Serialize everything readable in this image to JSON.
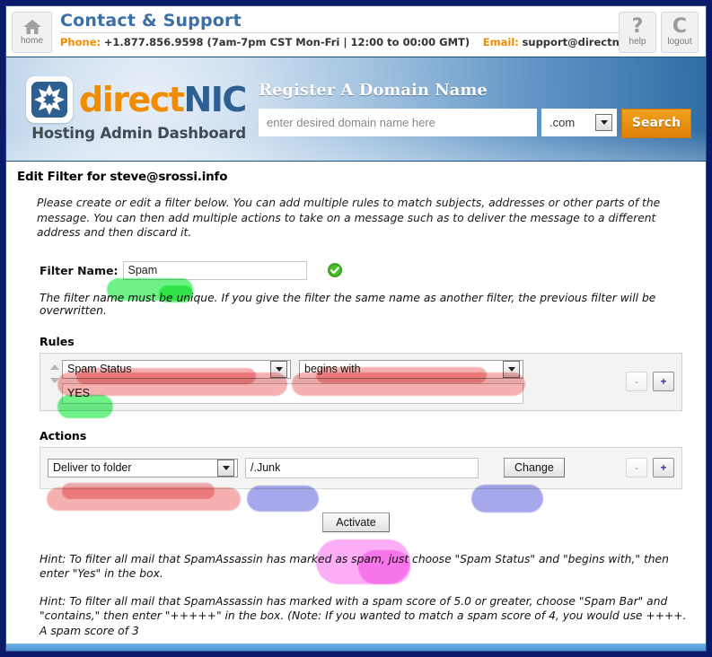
{
  "topbar": {
    "home_label": "home",
    "home_icon": "home-icon",
    "title": "Contact & Support",
    "phone_key": "Phone:",
    "phone_value": "+1.877.856.9598 (7am-7pm CST Mon-Fri  |  12:00 to 00:00 GMT)",
    "email_key": "Email:",
    "email_value": "support@directnic.com",
    "help_glyph": "?",
    "help_label": "help",
    "logout_glyph": "C",
    "logout_label": "logout"
  },
  "banner": {
    "logo_mark_icon": "directnic-starburst-icon",
    "logo_text_a": "direct",
    "logo_text_b": "NIC",
    "logo_subtitle": "Hosting Admin Dashboard",
    "register_title": "Register A Domain Name",
    "domain_placeholder": "enter desired domain name here",
    "domain_value": "",
    "tld_selected": ".com",
    "search_label": "Search"
  },
  "main": {
    "page_title": "Edit Filter for steve@srossi.info",
    "intro": "Please create or edit a filter below. You can add multiple rules to match subjects, addresses or other parts of the message. You can then add multiple actions to take on a message such as to deliver the message to a different address and then discard it.",
    "filter_name_label": "Filter Name:",
    "filter_name_value": "Spam",
    "valid_icon": "green-check-icon",
    "unique_note": "The filter name must be unique. If you give the filter the same name as another filter, the previous filter will be overwritten.",
    "rules_label": "Rules",
    "rule": {
      "condition": "Spam Status",
      "operator": "begins with",
      "value": "YES",
      "remove_label": "-",
      "add_label": "+"
    },
    "actions_label": "Actions",
    "action": {
      "type": "Deliver to folder",
      "value": "/.Junk",
      "change_label": "Change",
      "remove_label": "-",
      "add_label": "+"
    },
    "activate_label": "Activate",
    "hints": [
      "Hint: To filter all mail that SpamAssassin has marked as spam, just choose \"Spam Status\" and \"begins with,\" then enter \"Yes\" in the box.",
      "Hint: To filter all mail that SpamAssassin has marked with a spam score of 5.0 or greater, choose \"Spam Bar\" and \"contains,\" then enter \"+++++\" in the box. (Note: If you wanted to match a spam score of 4, you would use ++++. A spam score of 3"
    ]
  },
  "colors": {
    "accent_orange": "#f08c00",
    "brand_blue": "#2e5f93",
    "frame_navy": "#0b1a6b",
    "highlight_pink": "#f5a9a9",
    "highlight_green": "#5ef07a",
    "highlight_purple": "#9e9eea",
    "highlight_magenta": "#fba6f5"
  }
}
